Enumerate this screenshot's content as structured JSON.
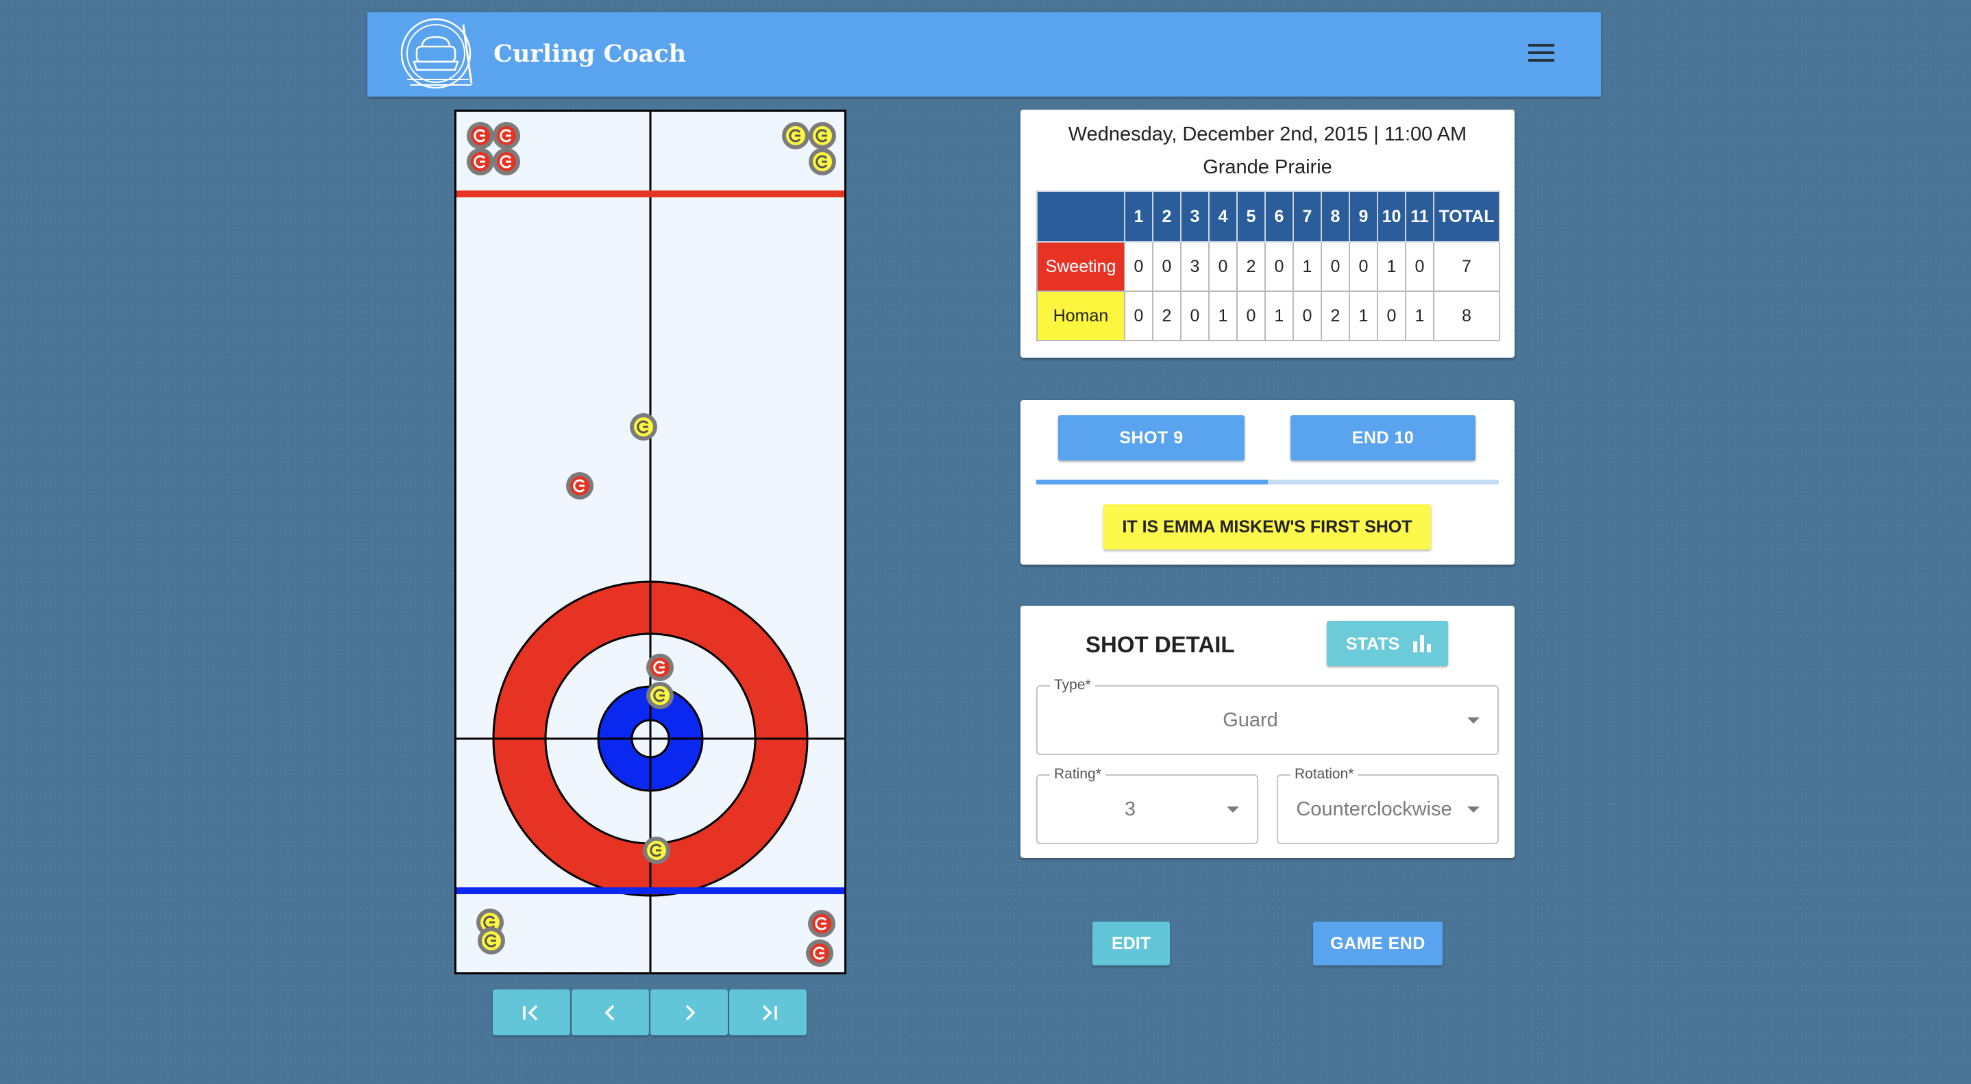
{
  "app": {
    "title": "Curling Coach"
  },
  "game": {
    "datetime": "Wednesday, December 2nd, 2015 | 11:00 AM",
    "location": "Grande Prairie"
  },
  "scoreboard": {
    "headers": [
      "1",
      "2",
      "3",
      "4",
      "5",
      "6",
      "7",
      "8",
      "9",
      "10",
      "11",
      "TOTAL"
    ],
    "teams": [
      {
        "name": "Sweeting",
        "color": "#e63323",
        "ends": [
          "0",
          "0",
          "3",
          "0",
          "2",
          "0",
          "1",
          "0",
          "0",
          "1",
          "0"
        ],
        "total": "7"
      },
      {
        "name": "Homan",
        "color": "#fcf63f",
        "ends": [
          "0",
          "2",
          "0",
          "1",
          "0",
          "1",
          "0",
          "2",
          "1",
          "0",
          "1"
        ],
        "total": "8"
      }
    ]
  },
  "shot_panel": {
    "shot_label": "SHOT 9",
    "end_label": "END 10",
    "progress_percent": 50,
    "turn_message": "IT IS EMMA MISKEW'S FIRST SHOT"
  },
  "shot_detail": {
    "title": "SHOT DETAIL",
    "stats_label": "STATS",
    "type": {
      "label": "Type*",
      "value": "Guard"
    },
    "rating": {
      "label": "Rating*",
      "value": "3"
    },
    "rotation": {
      "label": "Rotation*",
      "value": "Counterclockwise"
    }
  },
  "actions": {
    "edit_label": "EDIT",
    "game_end_label": "GAME END"
  },
  "navigation": [
    "first-shot-icon",
    "previous-shot-icon",
    "next-shot-icon",
    "last-shot-icon"
  ],
  "colors": {
    "red_team": "#e63323",
    "yellow_team": "#fcf63f",
    "house_outer": "#e63323",
    "house_button": "#0a28f0",
    "hog_line": "#e63323",
    "back_line": "#0a28f0",
    "primary": "#5aa3ee",
    "accent": "#62c6d8"
  }
}
